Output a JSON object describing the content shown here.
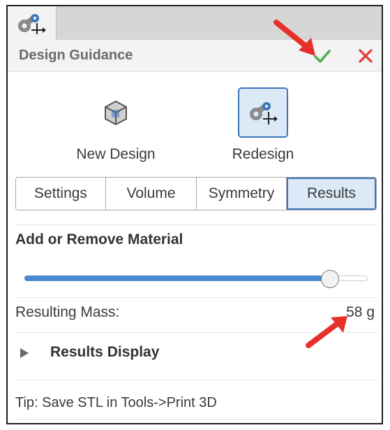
{
  "panel": {
    "title": "Design Guidance",
    "tab_icon": "redesign-icon",
    "ok_icon": "checkmark-icon",
    "close_icon": "close-icon"
  },
  "modes": [
    {
      "label": "New Design",
      "icon": "new-design-cube-icon",
      "selected": false
    },
    {
      "label": "Redesign",
      "icon": "redesign-icon",
      "selected": true
    }
  ],
  "tabs": [
    "Settings",
    "Volume",
    "Symmetry",
    "Results"
  ],
  "active_tab": "Results",
  "material": {
    "heading": "Add or Remove Material",
    "slider_fraction": 0.89
  },
  "mass": {
    "label": "Resulting Mass:",
    "value": "58 g"
  },
  "results_display": {
    "label": "Results Display",
    "expanded": false
  },
  "tip": "Tip: Save STL in Tools->Print 3D",
  "colors": {
    "accent_blue": "#3b75b8",
    "selected_bg": "#dce9f6",
    "ok_green": "#4caf50",
    "close_red": "#e53935",
    "annotation_arrow": "#e8302a"
  }
}
